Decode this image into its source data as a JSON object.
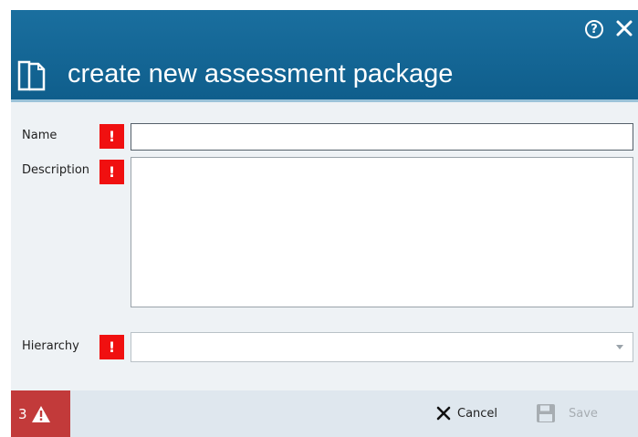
{
  "dialog": {
    "title": "create new assessment package",
    "help_icon": "help-circle-icon",
    "close_icon": "close-icon",
    "title_icon": "documents-icon"
  },
  "form": {
    "name_label": "Name",
    "description_label": "Description",
    "hierarchy_label": "Hierarchy",
    "required_marker": "!",
    "name_value": "",
    "description_value": "",
    "hierarchy_value": ""
  },
  "footer": {
    "error_count": "3",
    "cancel_label": "Cancel",
    "save_label": "Save"
  },
  "colors": {
    "header": "#0f5e8c",
    "required": "#f01010",
    "error_box": "#c23a3a"
  }
}
